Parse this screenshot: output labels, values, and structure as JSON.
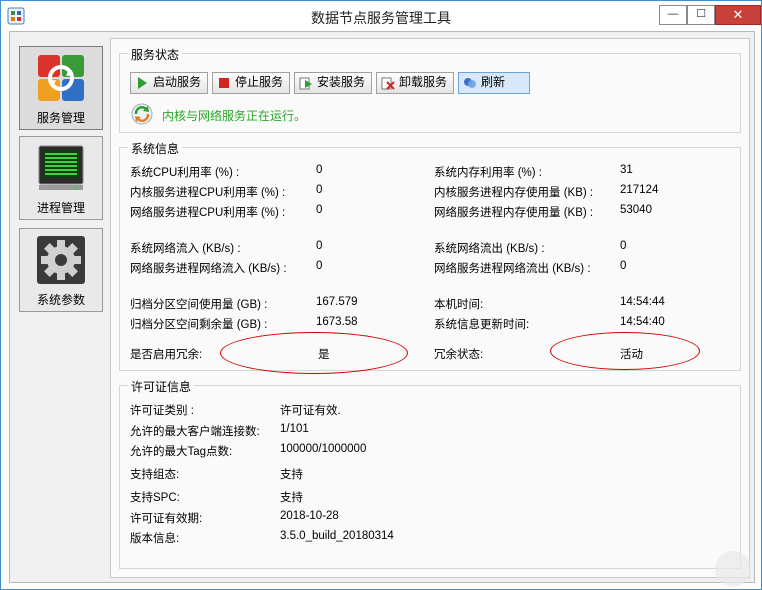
{
  "window": {
    "title": "数据节点服务管理工具",
    "minimize": "—",
    "maximize": "☐",
    "close": "✕"
  },
  "sidebar": {
    "items": [
      {
        "label": "服务管理",
        "icon": "service-management-icon"
      },
      {
        "label": "进程管理",
        "icon": "process-management-icon"
      },
      {
        "label": "系统参数",
        "icon": "gear-icon"
      }
    ]
  },
  "service_status": {
    "title": "服务状态",
    "buttons": [
      {
        "label": "启动服务",
        "icon": "play-icon"
      },
      {
        "label": "停止服务",
        "icon": "stop-icon"
      },
      {
        "label": "安装服务",
        "icon": "install-icon"
      },
      {
        "label": "卸载服务",
        "icon": "uninstall-icon"
      },
      {
        "label": "刷新",
        "icon": "refresh-icon"
      }
    ],
    "message": "内核与网络服务正在运行。"
  },
  "system_info": {
    "title": "系统信息",
    "rows": [
      {
        "label": "系统CPU利用率 (%) :",
        "value": "0"
      },
      {
        "label": "系统内存利用率 (%) :",
        "value": "31"
      },
      {
        "label": "内核服务进程CPU利用率 (%) :",
        "value": "0"
      },
      {
        "label": "内核服务进程内存使用量 (KB) :",
        "value": "217124"
      },
      {
        "label": "网络服务进程CPU利用率 (%) :",
        "value": "0"
      },
      {
        "label": "网络服务进程内存使用量 (KB) :",
        "value": "53040"
      },
      {
        "label": "系统网络流入 (KB/s) :",
        "value": "0"
      },
      {
        "label": "系统网络流出 (KB/s) :",
        "value": "0"
      },
      {
        "label": "网络服务进程网络流入 (KB/s) :",
        "value": "0"
      },
      {
        "label": "网络服务进程网络流出 (KB/s) :",
        "value": "0"
      },
      {
        "label": "归档分区空间使用量 (GB) :",
        "value": "167.579"
      },
      {
        "label": "本机时间:",
        "value": "14:54:44"
      },
      {
        "label": "归档分区空间剩余量 (GB) :",
        "value": "1673.58"
      },
      {
        "label": "系统信息更新时间:",
        "value": "14:54:40"
      }
    ],
    "redundancy_label": "是否启用冗余:",
    "redundancy_value": "是",
    "redundancy_state_label": "冗余状态:",
    "redundancy_state_value": "活动"
  },
  "license": {
    "title": "许可证信息",
    "rows": [
      {
        "label": "许可证类别 :",
        "value": "许可证有效."
      },
      {
        "label": "允许的最大客户端连接数:",
        "value": "1/101"
      },
      {
        "label": "允许的最大Tag点数:",
        "value": "100000/1000000"
      },
      {
        "label": "支持组态:",
        "value": "支持"
      },
      {
        "label": "支持SPC:",
        "value": "支持"
      },
      {
        "label": "许可证有效期:",
        "value": "2018-10-28"
      },
      {
        "label": "版本信息:",
        "value": "3.5.0_build_20180314"
      }
    ]
  },
  "colors": {
    "status_text": "#28a828",
    "annotation": "#d40000",
    "title_border": "#3f8fd0"
  }
}
